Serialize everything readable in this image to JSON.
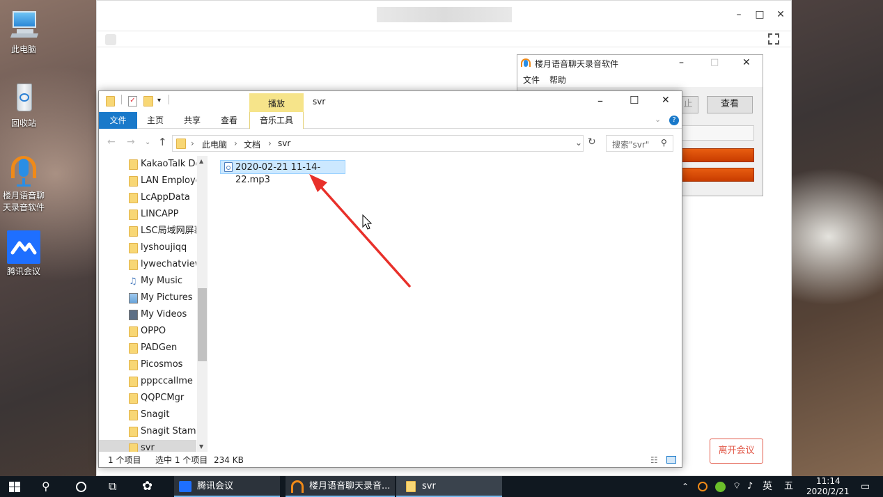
{
  "desktop": {
    "icons": [
      {
        "label": "此电脑"
      },
      {
        "label": "回收站"
      },
      {
        "label": "楼月语音聊天录音软件"
      },
      {
        "label": "腾讯会议"
      }
    ]
  },
  "meeting_window": {
    "leave_button": "离开会议",
    "controls": {
      "minimize": "–",
      "maximize": "□",
      "close": "✕"
    }
  },
  "recorder": {
    "title": "楼月语音聊天录音软件",
    "menu": [
      "文件",
      "帮助"
    ],
    "partial_button": "止",
    "view_button": "查看"
  },
  "explorer": {
    "context_tab": "播放",
    "window_title": "svr",
    "tabs": [
      "文件",
      "主页",
      "共享",
      "查看",
      "音乐工具"
    ],
    "breadcrumb": [
      "此电脑",
      "文档",
      "svr"
    ],
    "search_placeholder": "搜索\"svr\"",
    "nav_items": [
      {
        "label": "KakaoTalk Do",
        "type": "folder"
      },
      {
        "label": "LAN Employe",
        "type": "folder"
      },
      {
        "label": "LcAppData",
        "type": "folder"
      },
      {
        "label": "LINCAPP",
        "type": "folder"
      },
      {
        "label": "LSC局域网屏幕",
        "type": "folder"
      },
      {
        "label": "lyshoujiqq",
        "type": "folder"
      },
      {
        "label": "lywechatviewe",
        "type": "folder"
      },
      {
        "label": "My Music",
        "type": "music"
      },
      {
        "label": "My Pictures",
        "type": "pictures"
      },
      {
        "label": "My Videos",
        "type": "videos"
      },
      {
        "label": "OPPO",
        "type": "folder"
      },
      {
        "label": "PADGen",
        "type": "folder"
      },
      {
        "label": "Picosmos",
        "type": "folder"
      },
      {
        "label": "pppccallme",
        "type": "folder"
      },
      {
        "label": "QQPCMgr",
        "type": "folder"
      },
      {
        "label": "Snagit",
        "type": "folder"
      },
      {
        "label": "Snagit Stamp",
        "type": "folder"
      },
      {
        "label": "svr",
        "type": "folder",
        "selected": true
      }
    ],
    "file": "2020-02-21 11-14-22.mp3",
    "status": {
      "count": "1 个项目",
      "selected": "选中 1 个项目",
      "size": "234 KB"
    }
  },
  "taskbar": {
    "apps": [
      "腾讯会议",
      "楼月语音聊天录音...",
      "svr"
    ],
    "ime": "英",
    "ime2": "五",
    "time": "11:14",
    "date": "2020/2/21"
  },
  "colors": {
    "accent": "#1979ca",
    "arrow": "#e8302a",
    "context_tab": "#f6e48a"
  }
}
